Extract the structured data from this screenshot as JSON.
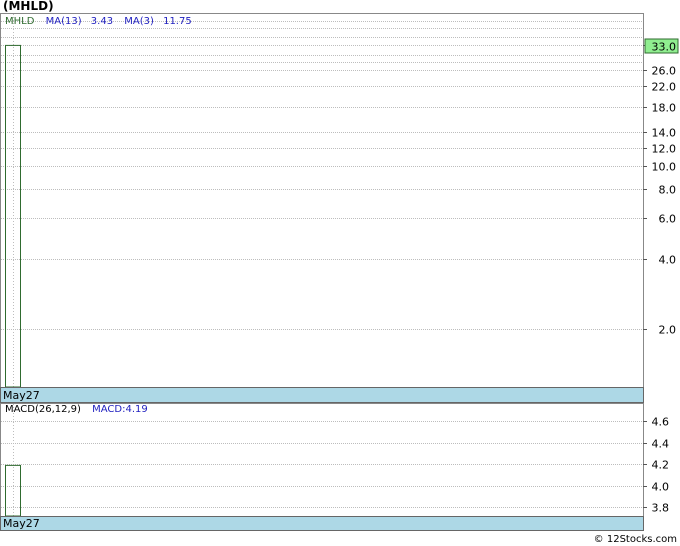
{
  "header": {
    "symbol_title": "(MHLD)"
  },
  "price_panel": {
    "legend": {
      "symbol": "MHLD",
      "ma13_label": "MA(13)",
      "ma13_value": "3.43",
      "ma3_label": "MA(3)",
      "ma3_value": "11.75"
    },
    "last_price_tag": "33.0",
    "date_label": "May27"
  },
  "macd_panel": {
    "legend": {
      "label": "MACD(26,12,9)",
      "macd_text": "MACD:4.19"
    },
    "date_label": "May27"
  },
  "footer": {
    "copyright": "© 12Stocks.com"
  },
  "colors": {
    "price_bar": "#2f6b2f",
    "legend_blue": "#1f1fbf",
    "date_band": "#add8e6",
    "grid": "#bdbdbd",
    "price_tag_bg": "#90ee90"
  },
  "chart_data": [
    {
      "type": "bar",
      "title": "(MHLD)",
      "scale": "log",
      "x": [
        "May27"
      ],
      "series": [
        {
          "name": "MHLD",
          "values": [
            33.0
          ]
        }
      ],
      "indicators": [
        {
          "name": "MA(13)",
          "value": 3.43
        },
        {
          "name": "MA(3)",
          "value": 11.75
        }
      ],
      "last_value": 33.0,
      "ylim": [
        1.13,
        45.0
      ],
      "yticks": [
        2.0,
        4.0,
        6.0,
        8.0,
        10.0,
        12.0,
        14.0,
        18.0,
        22.0,
        26.0,
        33.0
      ],
      "grid": true
    },
    {
      "type": "bar",
      "title": "MACD(26,12,9)",
      "x": [
        "May27"
      ],
      "series": [
        {
          "name": "MACD",
          "values": [
            4.19
          ]
        }
      ],
      "ylim": [
        3.72,
        4.76
      ],
      "yticks": [
        3.8,
        4.0,
        4.2,
        4.4,
        4.6
      ],
      "grid": true
    }
  ]
}
